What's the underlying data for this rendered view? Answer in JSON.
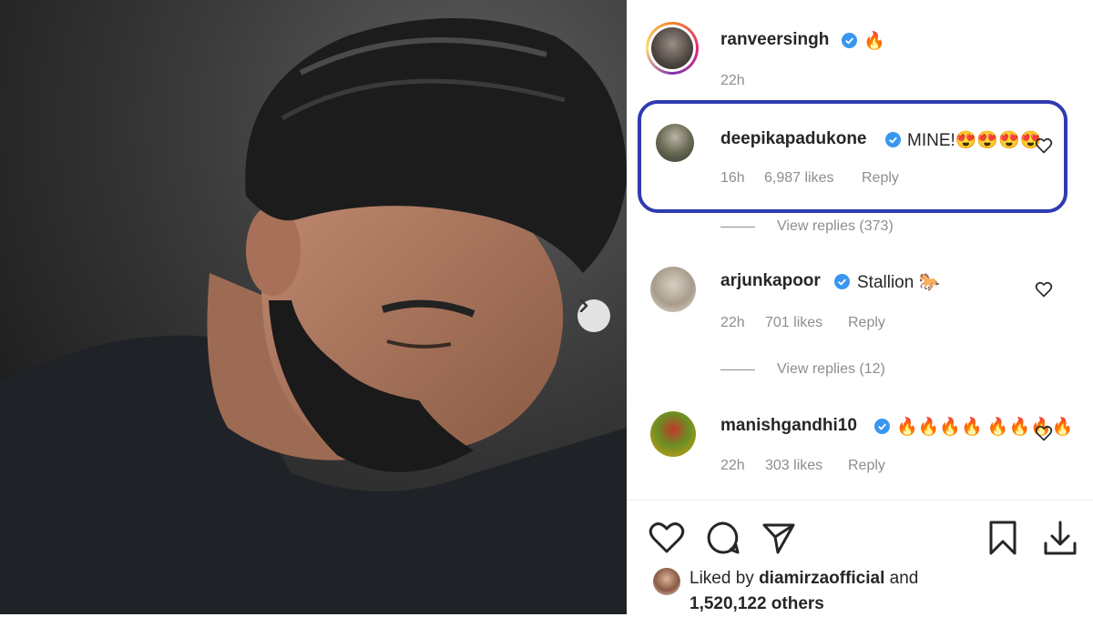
{
  "post": {
    "carousel_next_icon": "chevron-right-icon"
  },
  "caption": {
    "username": "ranveersingh",
    "text": "🔥",
    "time": "22h"
  },
  "comments": [
    {
      "username": "deepikapadukone",
      "text": "MINE!😍😍😍😍",
      "time": "16h",
      "likes": "6,987 likes",
      "reply": "Reply",
      "view_replies": "View replies (373)"
    },
    {
      "username": "arjunkapoor",
      "text": "Stallion 🐎",
      "time": "22h",
      "likes": "701 likes",
      "reply": "Reply",
      "view_replies": "View replies (12)"
    },
    {
      "username": "manishgandhi10",
      "text": "🔥🔥🔥🔥 🔥🔥🔥🔥",
      "time": "22h",
      "likes": "303 likes",
      "reply": "Reply"
    }
  ],
  "actions": {
    "like": "heart-icon",
    "comment": "comment-icon",
    "share": "send-icon",
    "save": "bookmark-icon",
    "download": "download-icon"
  },
  "likes_summary": {
    "prefix": "Liked by",
    "user": "diamirzaofficial",
    "and": "and",
    "count": "1,520,122 others"
  },
  "colors": {
    "verified": "#3897f0",
    "highlight_border": "#2f3bb0",
    "text_primary": "#262626",
    "text_secondary": "#8e8e8e"
  }
}
